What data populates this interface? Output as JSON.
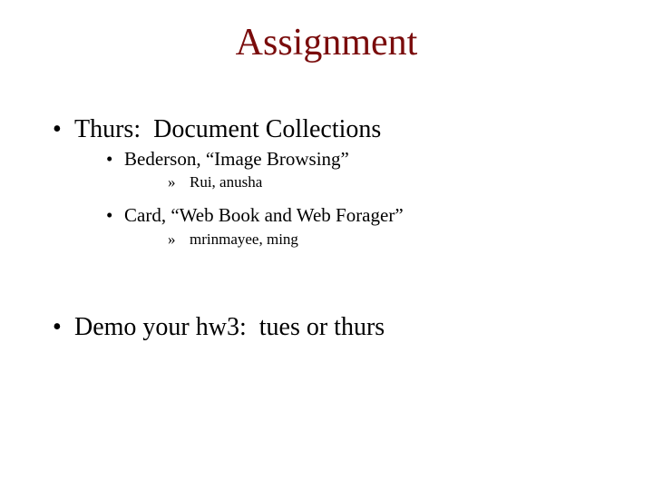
{
  "slide": {
    "title": "Assignment",
    "title_color": "#7a0c0c",
    "items": [
      {
        "bullet": "•",
        "text": "Thurs:  Document Collections",
        "children": [
          {
            "bullet": "•",
            "text": "Bederson, “Image Browsing”",
            "children": [
              {
                "bullet": "»",
                "text": "Rui, anusha"
              }
            ]
          },
          {
            "bullet": "•",
            "text": "Card, “Web Book and Web Forager”",
            "children": [
              {
                "bullet": "»",
                "text": "mrinmayee, ming"
              }
            ]
          }
        ]
      },
      {
        "bullet": "•",
        "text": "Demo your hw3:  tues or thurs",
        "children": []
      }
    ]
  }
}
